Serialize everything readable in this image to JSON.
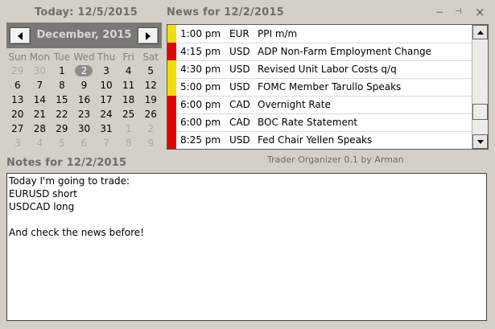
{
  "calendar": {
    "title": "Today: 12/5/2015",
    "month_label": "December, 2015",
    "weekdays": [
      "Sun",
      "Mon",
      "Tue",
      "Wed",
      "Thu",
      "Fri",
      "Sat"
    ],
    "days": [
      {
        "d": "29",
        "other": true
      },
      {
        "d": "30",
        "other": true
      },
      {
        "d": "1"
      },
      {
        "d": "2",
        "today": true
      },
      {
        "d": "3"
      },
      {
        "d": "4"
      },
      {
        "d": "5"
      },
      {
        "d": "6"
      },
      {
        "d": "7"
      },
      {
        "d": "8"
      },
      {
        "d": "9"
      },
      {
        "d": "10"
      },
      {
        "d": "11"
      },
      {
        "d": "12"
      },
      {
        "d": "13"
      },
      {
        "d": "14"
      },
      {
        "d": "15"
      },
      {
        "d": "16"
      },
      {
        "d": "17"
      },
      {
        "d": "18"
      },
      {
        "d": "19"
      },
      {
        "d": "20"
      },
      {
        "d": "21"
      },
      {
        "d": "22"
      },
      {
        "d": "23"
      },
      {
        "d": "24"
      },
      {
        "d": "25"
      },
      {
        "d": "26"
      },
      {
        "d": "27"
      },
      {
        "d": "28"
      },
      {
        "d": "29"
      },
      {
        "d": "30"
      },
      {
        "d": "31"
      },
      {
        "d": "1",
        "other": true
      },
      {
        "d": "2",
        "other": true
      },
      {
        "d": "3",
        "other": true
      },
      {
        "d": "4",
        "other": true
      },
      {
        "d": "5",
        "other": true
      },
      {
        "d": "6",
        "other": true
      },
      {
        "d": "7",
        "other": true
      },
      {
        "d": "8",
        "other": true
      },
      {
        "d": "9",
        "other": true
      }
    ]
  },
  "news": {
    "title": "News for 12/2/2015",
    "controls": {
      "minimize": "−",
      "pin": "⊣",
      "close": "×"
    },
    "importance_colors": {
      "medium": "#f0e000",
      "high": "#e00000"
    },
    "items": [
      {
        "time": "1:00 pm",
        "currency": "EUR",
        "title": "PPI m/m",
        "impact": "medium"
      },
      {
        "time": "4:15 pm",
        "currency": "USD",
        "title": "ADP Non-Farm Employment Change",
        "impact": "high"
      },
      {
        "time": "4:30 pm",
        "currency": "USD",
        "title": "Revised Unit Labor Costs q/q",
        "impact": "medium"
      },
      {
        "time": "5:00 pm",
        "currency": "USD",
        "title": "FOMC Member Tarullo Speaks",
        "impact": "medium"
      },
      {
        "time": "6:00 pm",
        "currency": "CAD",
        "title": "Overnight Rate",
        "impact": "high"
      },
      {
        "time": "6:00 pm",
        "currency": "CAD",
        "title": "BOC Rate Statement",
        "impact": "high"
      },
      {
        "time": "8:25 pm",
        "currency": "USD",
        "title": "Fed Chair Yellen Speaks",
        "impact": "high"
      }
    ]
  },
  "credit": "Trader Organizer 0.1 by Arman",
  "notes": {
    "title": "Notes for 12/2/2015",
    "text": "Today I'm going to trade:\nEURUSD short\nUSDCAD long\n\nAnd check the news before!"
  }
}
